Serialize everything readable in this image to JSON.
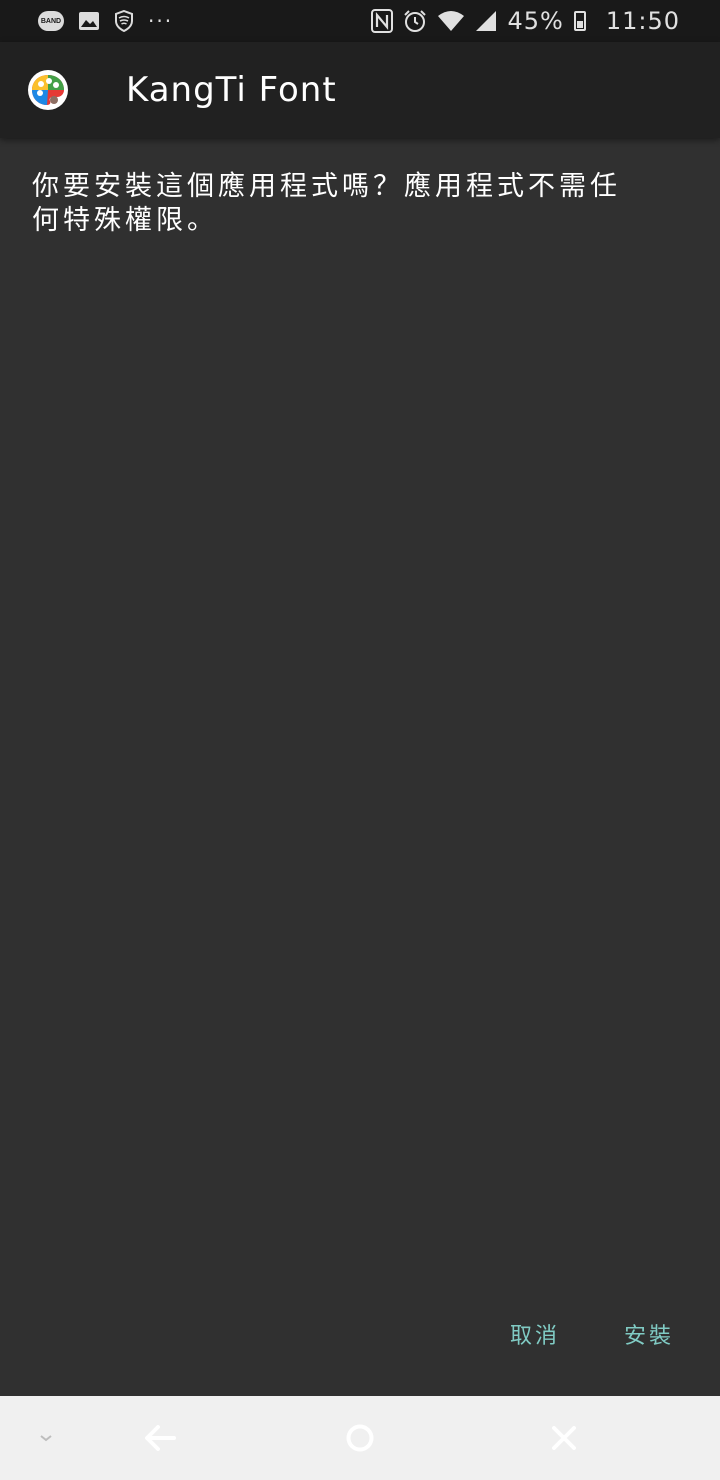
{
  "status_bar": {
    "band_label": "BAND",
    "more_indicator": "···",
    "battery_percent": "45%",
    "time": "11:50",
    "icons": [
      "band-icon",
      "gallery-icon",
      "vpn-shield-icon",
      "nfc-icon",
      "alarm-icon",
      "wifi-icon",
      "cellular-signal-icon",
      "battery-icon"
    ]
  },
  "app_bar": {
    "icon": "palette-app-icon",
    "title": "KangTi Font"
  },
  "dialog": {
    "message": "你要安裝這個應用程式嗎？應用程式不需任何特殊權限。",
    "cancel_label": "取消",
    "install_label": "安裝",
    "accent_color": "#80cbc4"
  },
  "nav_bar": {
    "icons": [
      "hide-nav-chevron-icon",
      "back-arrow-icon",
      "home-circle-icon",
      "close-x-icon"
    ]
  }
}
